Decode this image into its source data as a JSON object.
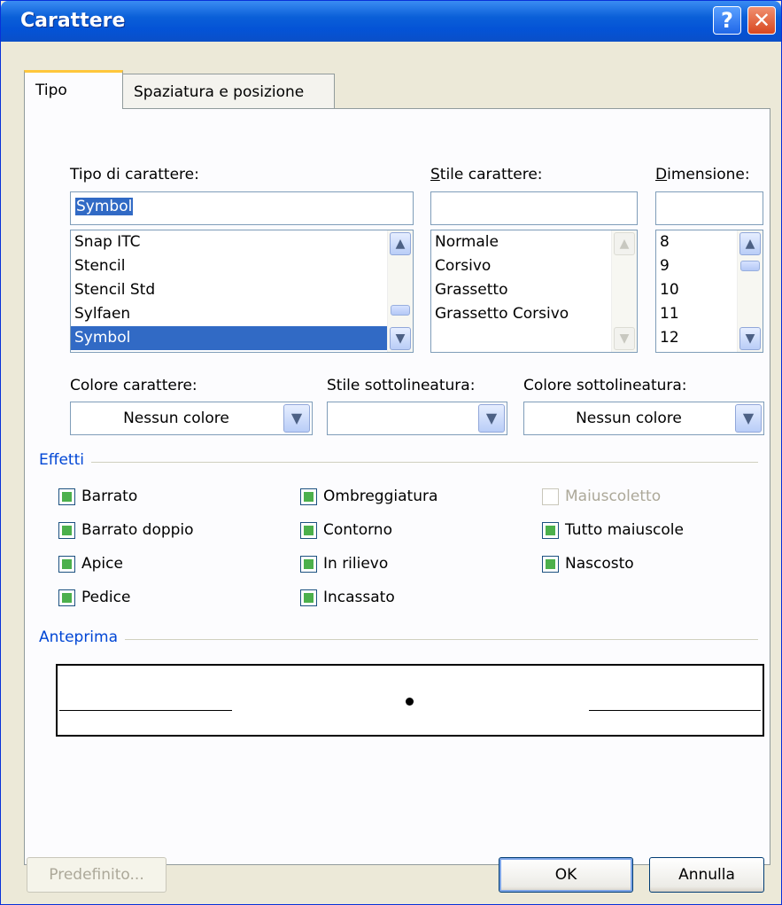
{
  "window": {
    "title": "Carattere",
    "help_glyph": "?",
    "close_glyph": "✕"
  },
  "tabs": [
    {
      "label": "Tipo",
      "active": true
    },
    {
      "label": "Spaziatura e posizione",
      "active": false
    }
  ],
  "font_family": {
    "label": "Tipo di carattere:",
    "value": "Symbol",
    "items": [
      "Snap ITC",
      "Stencil",
      "Stencil Std",
      "Sylfaen",
      "Symbol"
    ],
    "selected": "Symbol"
  },
  "font_style": {
    "label": "Stile carattere:",
    "value": "",
    "items": [
      "Normale",
      "Corsivo",
      "Grassetto",
      "Grassetto Corsivo"
    ]
  },
  "font_size": {
    "label": "Dimensione:",
    "value": "",
    "items": [
      "8",
      "9",
      "10",
      "11",
      "12"
    ]
  },
  "font_color": {
    "label": "Colore carattere:",
    "value": "Nessun colore"
  },
  "underline_style": {
    "label": "Stile sottolineatura:",
    "value": ""
  },
  "underline_color": {
    "label": "Colore sottolineatura:",
    "value": "Nessun colore"
  },
  "effects": {
    "title": "Effetti",
    "strikethrough": "Barrato",
    "double_strikethrough": "Barrato doppio",
    "superscript": "Apice",
    "subscript": "Pedice",
    "shadow": "Ombreggiatura",
    "outline": "Contorno",
    "emboss": "In rilievo",
    "engrave": "Incassato",
    "small_caps": "Maiuscoletto",
    "all_caps": "Tutto maiuscole",
    "hidden": "Nascosto"
  },
  "preview": {
    "title": "Anteprima"
  },
  "buttons": {
    "default": "Predefinito...",
    "ok": "OK",
    "cancel": "Annulla"
  },
  "colors": {
    "accent": "#0046d5",
    "selection": "#316ac5",
    "titlebar": "#0453d6",
    "checkbox_fill": "#4cb04c"
  }
}
